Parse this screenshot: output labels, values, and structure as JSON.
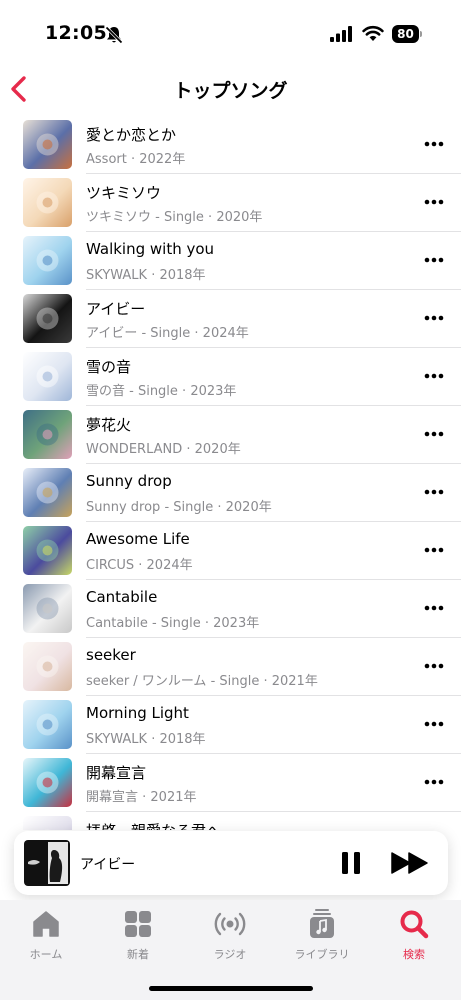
{
  "status": {
    "time": "12:05",
    "battery": "80",
    "icons": [
      "silent-bell-icon",
      "signal-icon",
      "wifi-icon",
      "battery-icon"
    ]
  },
  "nav": {
    "title": "トップソング",
    "back_icon": "chevron-left-icon"
  },
  "colors": {
    "accent": "#e62a4b",
    "secondary_text": "#8a8a8e",
    "divider": "#e2e2e4",
    "tab_bar": "#f3f3f5"
  },
  "songs": [
    {
      "title": "愛とか恋とか",
      "subtitle": "Assort · 2022年",
      "art": [
        "#5b6fa8",
        "#c9703e",
        "#e8e0d6"
      ]
    },
    {
      "title": "ツキミソウ",
      "subtitle": "ツキミソウ - Single · 2020年",
      "art": [
        "#f4d9b8",
        "#d9a06a",
        "#fff4e8"
      ]
    },
    {
      "title": "Walking with you",
      "subtitle": "SKYWALK · 2018年",
      "art": [
        "#9fd3ee",
        "#5a92c8",
        "#e6f3fb"
      ]
    },
    {
      "title": "アイビー",
      "subtitle": "アイビー - Single · 2024年",
      "art": [
        "#141414",
        "#3a3a3a",
        "#d8d8d8"
      ]
    },
    {
      "title": "雪の音",
      "subtitle": "雪の音 - Single · 2023年",
      "art": [
        "#dfe6f2",
        "#9fb6d8",
        "#ffffff"
      ]
    },
    {
      "title": "夢花火",
      "subtitle": "WONDERLAND · 2020年",
      "art": [
        "#6fa37a",
        "#e0a0b8",
        "#3f6f86"
      ]
    },
    {
      "title": "Sunny drop",
      "subtitle": "Sunny drop - Single · 2020年",
      "art": [
        "#5f7fb3",
        "#c8a35a",
        "#e8eef8"
      ]
    },
    {
      "title": "Awesome Life",
      "subtitle": "CIRCUS · 2024年",
      "art": [
        "#4b4b9e",
        "#c8d865",
        "#8fd0a8"
      ]
    },
    {
      "title": "Cantabile",
      "subtitle": "Cantabile - Single · 2023年",
      "art": [
        "#f2f2f2",
        "#c8c8c8",
        "#8a9ab0"
      ]
    },
    {
      "title": "seeker",
      "subtitle": "seeker / ワンルーム - Single · 2021年",
      "art": [
        "#f0e2e4",
        "#d8b8a0",
        "#fbf6f2"
      ]
    },
    {
      "title": "Morning Light",
      "subtitle": "SKYWALK · 2018年",
      "art": [
        "#9fd3ee",
        "#5a92c8",
        "#e6f3fb"
      ]
    },
    {
      "title": "開幕宣言",
      "subtitle": "開幕宣言 · 2021年",
      "art": [
        "#3fb6d6",
        "#c83040",
        "#e8f6fa"
      ]
    },
    {
      "title": "拝啓、親愛なる君へ",
      "subtitle": "",
      "art": [
        "#e4e2ee",
        "#b8b0d0",
        "#ffffff"
      ]
    }
  ],
  "more_icon": "ellipsis-icon",
  "mini_player": {
    "title": "アイビー",
    "pause_icon": "pause-icon",
    "forward_icon": "forward-icon"
  },
  "tabs": [
    {
      "label": "ホーム",
      "icon": "home-icon",
      "active": false
    },
    {
      "label": "新着",
      "icon": "grid-icon",
      "active": false
    },
    {
      "label": "ラジオ",
      "icon": "radio-icon",
      "active": false
    },
    {
      "label": "ライブラリ",
      "icon": "library-icon",
      "active": false
    },
    {
      "label": "検索",
      "icon": "search-icon",
      "active": true
    }
  ]
}
